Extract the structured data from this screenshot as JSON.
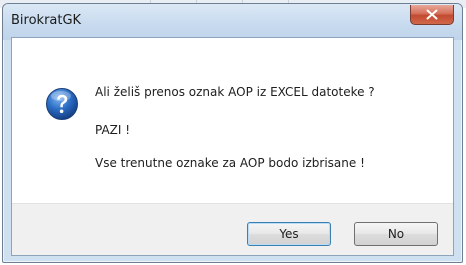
{
  "window": {
    "title": "BirokratGK"
  },
  "dialog": {
    "icon": "question-icon",
    "message_line_1": "Ali želiš prenos oznak AOP iz EXCEL datoteke ?",
    "message_line_2": "PAZI !",
    "message_line_3": "Vse trenutne oznake za AOP bodo izbrisane !"
  },
  "buttons": {
    "yes_label": "Yes",
    "no_label": "No"
  },
  "colors": {
    "titlebar": "#c8dbef",
    "close_button": "#c24a30",
    "default_button_border": "#3c7fb1",
    "icon_blue": "#1f5fb0"
  }
}
